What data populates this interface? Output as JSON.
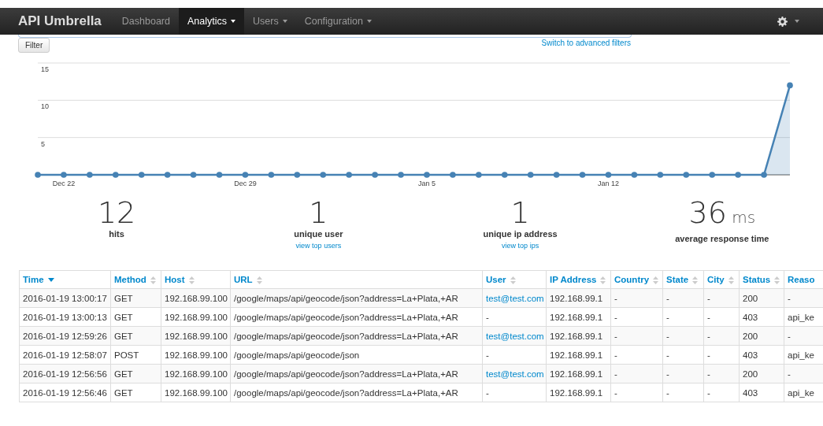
{
  "navbar": {
    "brand": "API Umbrella",
    "items": [
      {
        "label": "Dashboard",
        "selected": false,
        "dropdown": false
      },
      {
        "label": "Analytics",
        "selected": true,
        "dropdown": true
      },
      {
        "label": "Users",
        "selected": false,
        "dropdown": true
      },
      {
        "label": "Configuration",
        "selected": false,
        "dropdown": true
      }
    ]
  },
  "filter": {
    "button": "Filter",
    "advanced_link": "Switch to advanced filters"
  },
  "chart_data": {
    "type": "area",
    "categories": [
      null,
      "Dec 22",
      null,
      null,
      null,
      null,
      null,
      null,
      "Dec 29",
      null,
      null,
      null,
      null,
      null,
      null,
      "Jan 5",
      null,
      null,
      null,
      null,
      null,
      null,
      "Jan 12",
      null,
      null,
      null,
      null,
      null,
      null,
      null
    ],
    "series": [
      {
        "color": "#4682b4",
        "values": [
          0,
          0,
          0,
          0,
          0,
          0,
          0,
          0,
          0,
          0,
          0,
          0,
          0,
          0,
          0,
          0,
          0,
          0,
          0,
          0,
          0,
          0,
          0,
          0,
          0,
          0,
          0,
          0,
          0,
          12
        ]
      }
    ],
    "ylim": [
      0,
      15
    ],
    "yticks": [
      5,
      10,
      15
    ]
  },
  "stats": [
    {
      "value": "12",
      "label": "hits"
    },
    {
      "value": "1",
      "label": "unique user",
      "link": "view top users"
    },
    {
      "value": "1",
      "label": "unique ip address",
      "link": "view top ips"
    },
    {
      "value": "36",
      "unit": "ms",
      "label": "average response time"
    }
  ],
  "table": {
    "columns": [
      {
        "label": "Time",
        "sorted": true
      },
      {
        "label": "Method",
        "sorted": false
      },
      {
        "label": "Host",
        "sorted": false
      },
      {
        "label": "URL",
        "sorted": false
      },
      {
        "label": "User",
        "sorted": false
      },
      {
        "label": "IP Address",
        "sorted": false
      },
      {
        "label": "Country",
        "sorted": false
      },
      {
        "label": "State",
        "sorted": false
      },
      {
        "label": "City",
        "sorted": false
      },
      {
        "label": "Status",
        "sorted": false
      },
      {
        "label": "Reaso"
      }
    ],
    "rows": [
      {
        "cells": [
          "2016-01-19 13:00:17",
          "GET",
          "192.168.99.100",
          "/google/maps/api/geocode/json?address=La+Plata,+AR",
          "test@test.com",
          "192.168.99.1",
          "-",
          "-",
          "-",
          "200",
          "-"
        ],
        "user_link": true
      },
      {
        "cells": [
          "2016-01-19 13:00:13",
          "GET",
          "192.168.99.100",
          "/google/maps/api/geocode/json?address=La+Plata,+AR",
          "-",
          "192.168.99.1",
          "-",
          "-",
          "-",
          "403",
          "api_ke"
        ],
        "user_link": false
      },
      {
        "cells": [
          "2016-01-19 12:59:26",
          "GET",
          "192.168.99.100",
          "/google/maps/api/geocode/json?address=La+Plata,+AR",
          "test@test.com",
          "192.168.99.1",
          "-",
          "-",
          "-",
          "200",
          "-"
        ],
        "user_link": true
      },
      {
        "cells": [
          "2016-01-19 12:58:07",
          "POST",
          "192.168.99.100",
          "/google/maps/api/geocode/json",
          "-",
          "192.168.99.1",
          "-",
          "-",
          "-",
          "403",
          "api_ke"
        ],
        "user_link": false
      },
      {
        "cells": [
          "2016-01-19 12:56:56",
          "GET",
          "192.168.99.100",
          "/google/maps/api/geocode/json?address=La+Plata,+AR",
          "test@test.com",
          "192.168.99.1",
          "-",
          "-",
          "-",
          "200",
          "-"
        ],
        "user_link": true
      },
      {
        "cells": [
          "2016-01-19 12:56:46",
          "GET",
          "192.168.99.100",
          "/google/maps/api/geocode/json?address=La+Plata,+AR",
          "-",
          "192.168.99.1",
          "-",
          "-",
          "-",
          "403",
          "api_ke"
        ],
        "user_link": false
      }
    ]
  }
}
